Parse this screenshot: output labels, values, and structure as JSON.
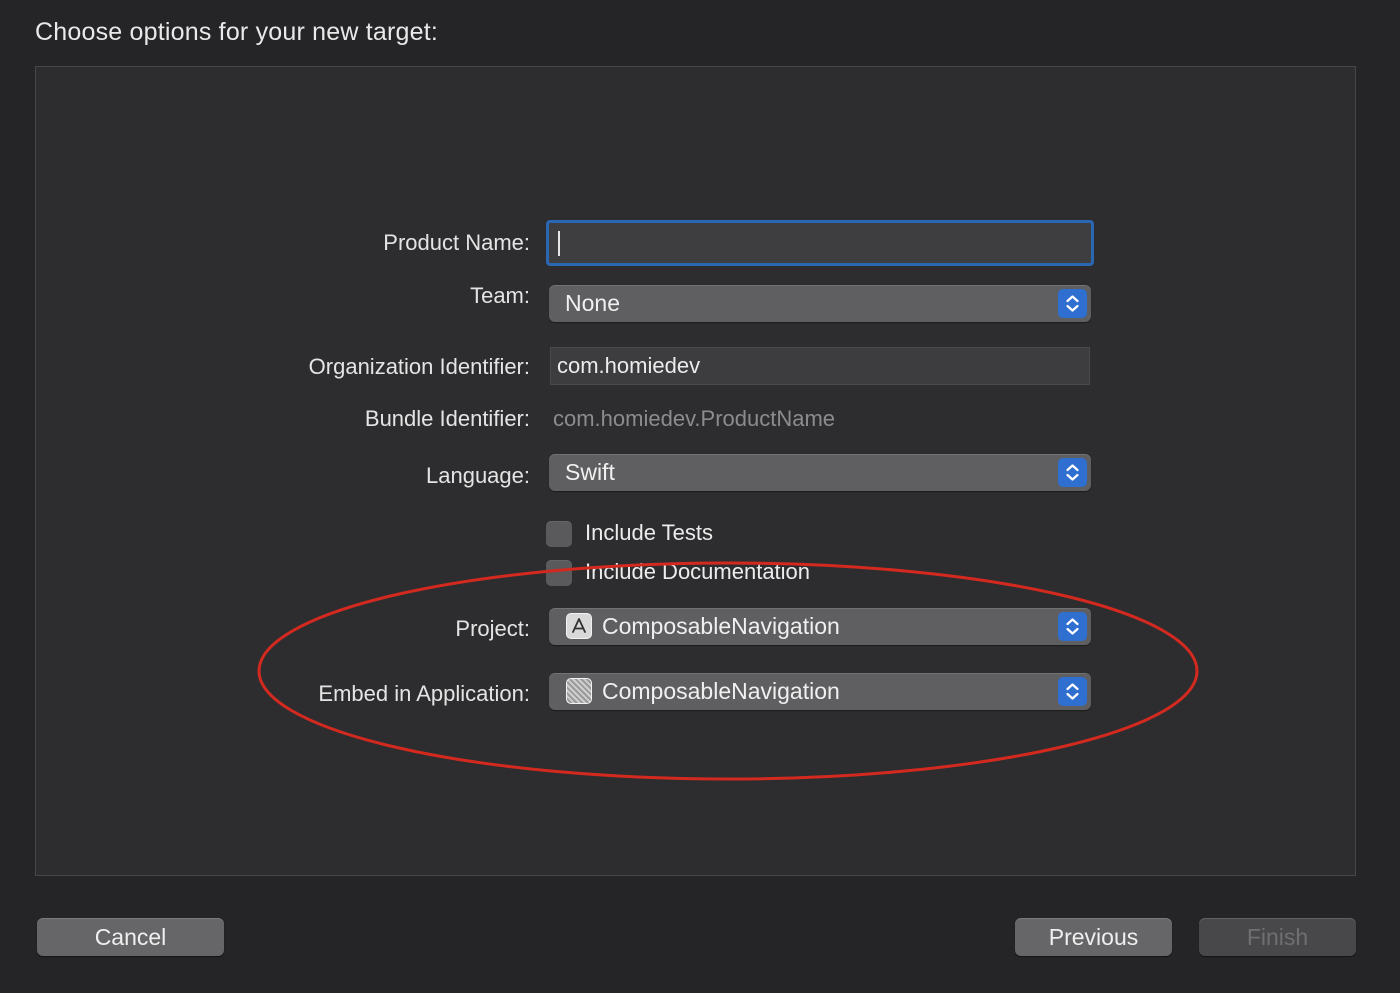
{
  "window": {
    "title": "Choose options for your new target:"
  },
  "form": {
    "product_name": {
      "label": "Product Name:",
      "value": ""
    },
    "team": {
      "label": "Team:",
      "value": "None"
    },
    "organization_identifier": {
      "label": "Organization Identifier:",
      "value": "com.homiedev"
    },
    "bundle_identifier": {
      "label": "Bundle Identifier:",
      "value": "com.homiedev.ProductName"
    },
    "language": {
      "label": "Language:",
      "value": "Swift"
    },
    "include_tests": {
      "label": "Include Tests",
      "checked": false
    },
    "include_documentation": {
      "label": "Include Documentation",
      "checked": false
    },
    "project": {
      "label": "Project:",
      "value": "ComposableNavigation",
      "icon": "app-store-icon"
    },
    "embed_in_application": {
      "label": "Embed in Application:",
      "value": "ComposableNavigation",
      "icon": "app-icon"
    }
  },
  "footer": {
    "cancel_label": "Cancel",
    "previous_label": "Previous",
    "finish_label": "Finish"
  },
  "colors": {
    "focus_ring": "#2a67b3",
    "stepper_accent": "#2f6fd0",
    "annotation": "#d4291f"
  }
}
